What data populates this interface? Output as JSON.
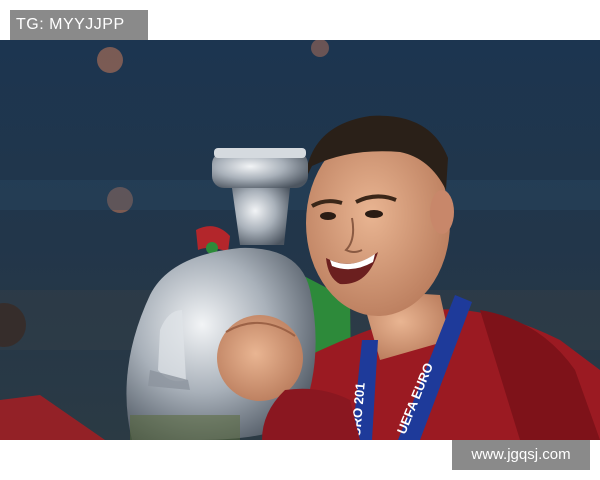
{
  "watermarks": {
    "top_left": "TG: MYYJJPP",
    "bottom_right": "www.jgqsj.com"
  },
  "photo": {
    "lanyard_text_left": "URO 201",
    "lanyard_text_right": "UEFA EURO"
  },
  "colors": {
    "background": "#ffffff",
    "watermark_bg": "#8a8a8a",
    "jersey": "#9b1a22",
    "lanyard": "#1e3a9a"
  }
}
